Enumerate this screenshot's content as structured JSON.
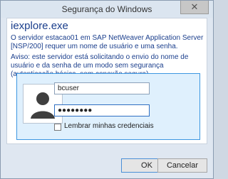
{
  "window": {
    "title": "Segurança do Windows",
    "close_label": "✕"
  },
  "dialog": {
    "heading": "iexplore.exe",
    "message": "O servidor estacao01 em SAP NetWeaver Application Server [NSP/200] requer um nome de usuário e uma senha.",
    "warning": "Aviso: este servidor está solicitando o envio do nome de usuário e da senha de um modo sem segurança (autenticação básica, sem conexão segura)."
  },
  "credentials": {
    "username_value": "bcuser",
    "password_mask": "●●●●●●●●",
    "remember_label": "Lembrar minhas credenciais",
    "remember_checked": false
  },
  "buttons": {
    "ok_label": "OK",
    "cancel_label": "Cancelar"
  },
  "colors": {
    "accent": "#3d97e1",
    "heading_text": "#1a3e8c",
    "panel_bg": "#dff0fd"
  }
}
